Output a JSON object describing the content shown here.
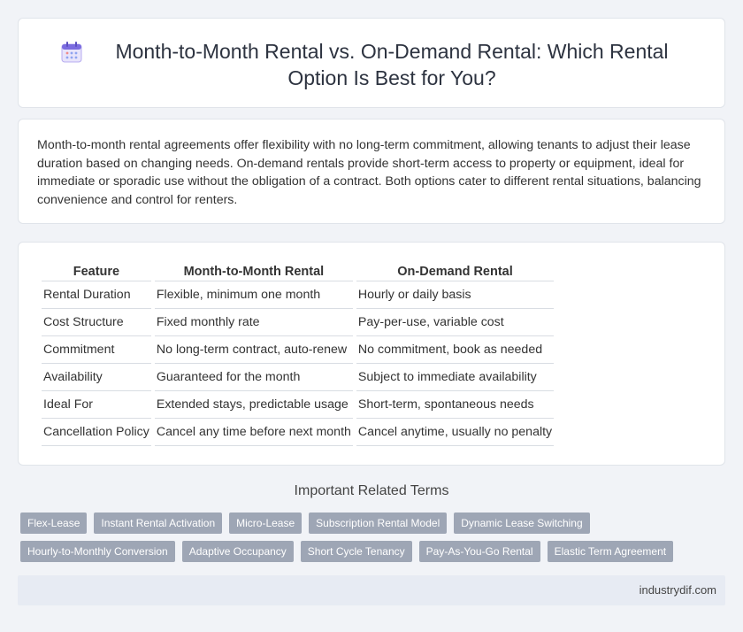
{
  "header": {
    "title": "Month-to-Month Rental vs. On-Demand Rental: Which Rental Option Is Best for You?",
    "icon": "calendar-icon"
  },
  "intro": {
    "text": "Month-to-month rental agreements offer flexibility with no long-term commitment, allowing tenants to adjust their lease duration based on changing needs. On-demand rentals provide short-term access to property or equipment, ideal for immediate or sporadic use without the obligation of a contract. Both options cater to different rental situations, balancing convenience and control for renters."
  },
  "table": {
    "headers": [
      "Feature",
      "Month-to-Month Rental",
      "On-Demand Rental"
    ],
    "rows": [
      [
        "Rental Duration",
        "Flexible, minimum one month",
        "Hourly or daily basis"
      ],
      [
        "Cost Structure",
        "Fixed monthly rate",
        "Pay-per-use, variable cost"
      ],
      [
        "Commitment",
        "No long-term contract, auto-renew",
        "No commitment, book as needed"
      ],
      [
        "Availability",
        "Guaranteed for the month",
        "Subject to immediate availability"
      ],
      [
        "Ideal For",
        "Extended stays, predictable usage",
        "Short-term, spontaneous needs"
      ],
      [
        "Cancellation Policy",
        "Cancel any time before next month",
        "Cancel anytime, usually no penalty"
      ]
    ]
  },
  "related": {
    "heading": "Important Related Terms",
    "tags_row1": [
      "Flex-Lease",
      "Instant Rental Activation",
      "Micro-Lease",
      "Subscription Rental Model",
      "Dynamic Lease Switching"
    ],
    "tags_row2": [
      "Hourly-to-Monthly Conversion",
      "Adaptive Occupancy",
      "Short Cycle Tenancy",
      "Pay-As-You-Go Rental",
      "Elastic Term Agreement"
    ]
  },
  "footer": {
    "site": "industrydif.com"
  },
  "colors": {
    "background": "#f1f3f7",
    "tag_background": "#9ea6b5",
    "footer_background": "#e7ebf3",
    "icon_accent": "#7b6ce0"
  }
}
